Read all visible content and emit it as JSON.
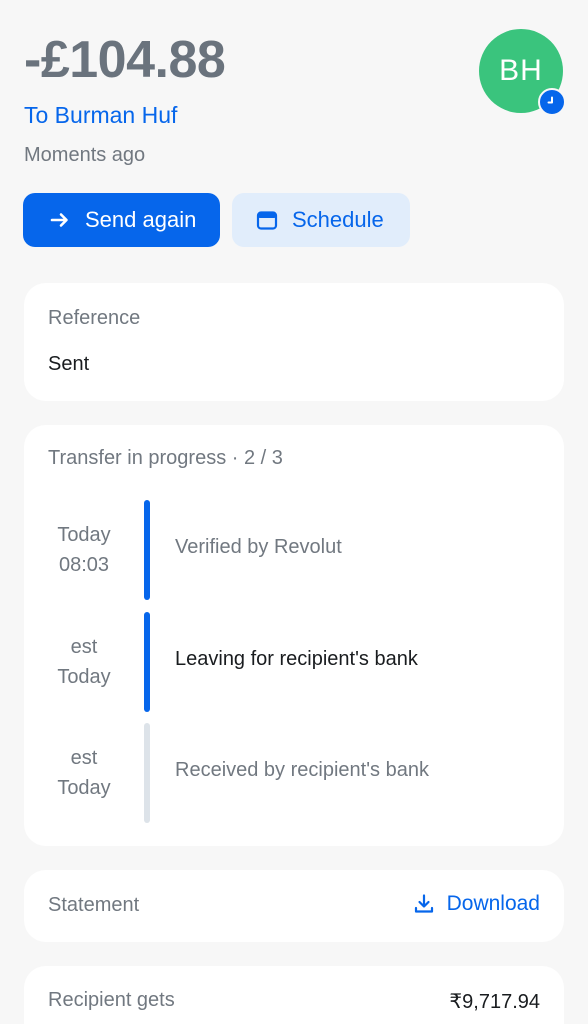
{
  "header": {
    "amount": "-£104.88",
    "recipient_line": "To Burman Huf",
    "timestamp": "Moments ago",
    "avatar_initials": "BH",
    "avatar_color": "#3ac47d",
    "avatar_badge_icon": "clock-icon"
  },
  "actions": {
    "send_again": {
      "label": "Send again",
      "icon": "arrow-right-icon"
    },
    "schedule": {
      "label": "Schedule",
      "icon": "calendar-icon"
    }
  },
  "reference": {
    "label": "Reference",
    "value": "Sent"
  },
  "progress": {
    "title": "Transfer in progress · 2 / 3",
    "steps": [
      {
        "time_line1": "Today",
        "time_line2": "08:03",
        "label": "Verified by Revolut",
        "state": "done"
      },
      {
        "time_line1": "est",
        "time_line2": "Today",
        "label": "Leaving for recipient's bank",
        "state": "current"
      },
      {
        "time_line1": "est",
        "time_line2": "Today",
        "label": "Received by recipient's bank",
        "state": "pending"
      }
    ]
  },
  "statement": {
    "label": "Statement",
    "download_label": "Download",
    "download_icon": "download-icon"
  },
  "recipient_gets": {
    "label": "Recipient gets",
    "value": "₹9,717.94"
  },
  "colors": {
    "accent": "#0666eb",
    "accent_soft": "#e1edfb",
    "muted_text": "#717880",
    "bar_active": "#0666eb",
    "bar_pending": "#dde3e9"
  }
}
